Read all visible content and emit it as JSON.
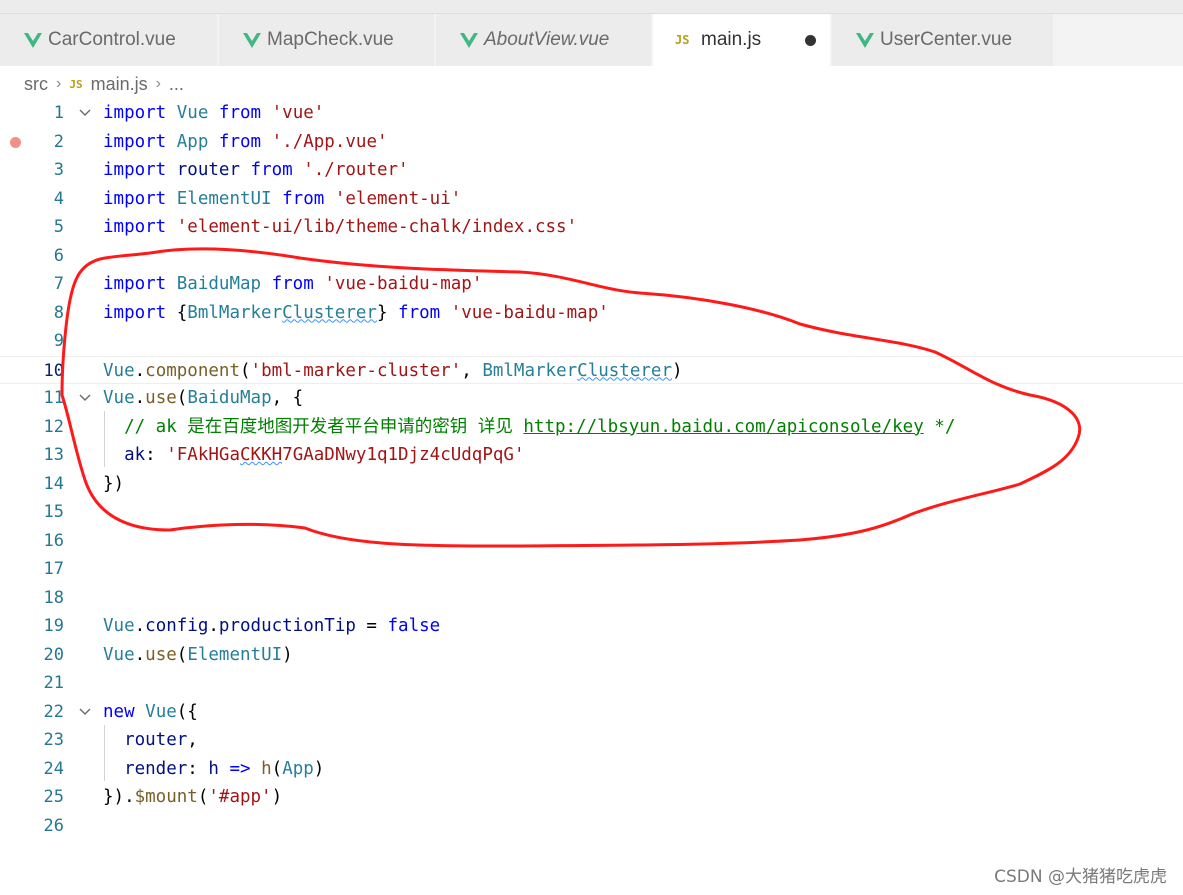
{
  "tabs": [
    {
      "label": "CarControl.vue",
      "icon": "vue-icon",
      "active": false,
      "italic": false
    },
    {
      "label": "MapCheck.vue",
      "icon": "vue-icon",
      "active": false,
      "italic": false
    },
    {
      "label": "AboutView.vue",
      "icon": "vue-icon",
      "active": false,
      "italic": true
    },
    {
      "label": "main.js",
      "icon": "js-icon",
      "icon_text": "JS",
      "active": true,
      "italic": false,
      "modified": true
    },
    {
      "label": "UserCenter.vue",
      "icon": "vue-icon",
      "active": false,
      "italic": false
    }
  ],
  "breadcrumb": {
    "folder": "src",
    "icon_text": "JS",
    "file": "main.js",
    "more": "..."
  },
  "editor": {
    "current_line": 10,
    "breakpoint_line": 2,
    "lines": [
      {
        "n": "1",
        "text": "import Vue from 'vue'"
      },
      {
        "n": "2",
        "text": "import App from './App.vue'"
      },
      {
        "n": "3",
        "text": "import router from './router'"
      },
      {
        "n": "4",
        "text": "import ElementUI from 'element-ui'"
      },
      {
        "n": "5",
        "text": "import 'element-ui/lib/theme-chalk/index.css'"
      },
      {
        "n": "6",
        "text": ""
      },
      {
        "n": "7",
        "text": "import BaiduMap from 'vue-baidu-map'"
      },
      {
        "n": "8",
        "text": "import {BmlMarkerClusterer} from 'vue-baidu-map'"
      },
      {
        "n": "9",
        "text": ""
      },
      {
        "n": "10",
        "text": "Vue.component('bml-marker-cluster', BmlMarkerClusterer)"
      },
      {
        "n": "11",
        "text": "Vue.use(BaiduMap, {"
      },
      {
        "n": "12",
        "text": "  // ak 是在百度地图开发者平台申请的密钥 详见 http://lbsyun.baidu.com/apiconsole/key */"
      },
      {
        "n": "13",
        "text": "  ak: 'FAkHGaCKKH7GAaDNwy1q1Djz4cUdqPqG'"
      },
      {
        "n": "14",
        "text": "})"
      },
      {
        "n": "15",
        "text": ""
      },
      {
        "n": "16",
        "text": ""
      },
      {
        "n": "17",
        "text": ""
      },
      {
        "n": "18",
        "text": ""
      },
      {
        "n": "19",
        "text": "Vue.config.productionTip = false"
      },
      {
        "n": "20",
        "text": "Vue.use(ElementUI)"
      },
      {
        "n": "21",
        "text": ""
      },
      {
        "n": "22",
        "text": "new Vue({"
      },
      {
        "n": "23",
        "text": "  router,"
      },
      {
        "n": "24",
        "text": "  render: h => h(App)"
      },
      {
        "n": "25",
        "text": "}).$mount('#app')"
      },
      {
        "n": "26",
        "text": ""
      }
    ]
  },
  "colors": {
    "keyword": "#0000ff",
    "string": "#a31515",
    "type": "#267f99",
    "variable": "#001080",
    "function": "#795e26",
    "comment": "#008000",
    "line_number": "#237893",
    "annotation": "#ff1a1a"
  },
  "watermark": "CSDN @大猪猪吃虎虎"
}
